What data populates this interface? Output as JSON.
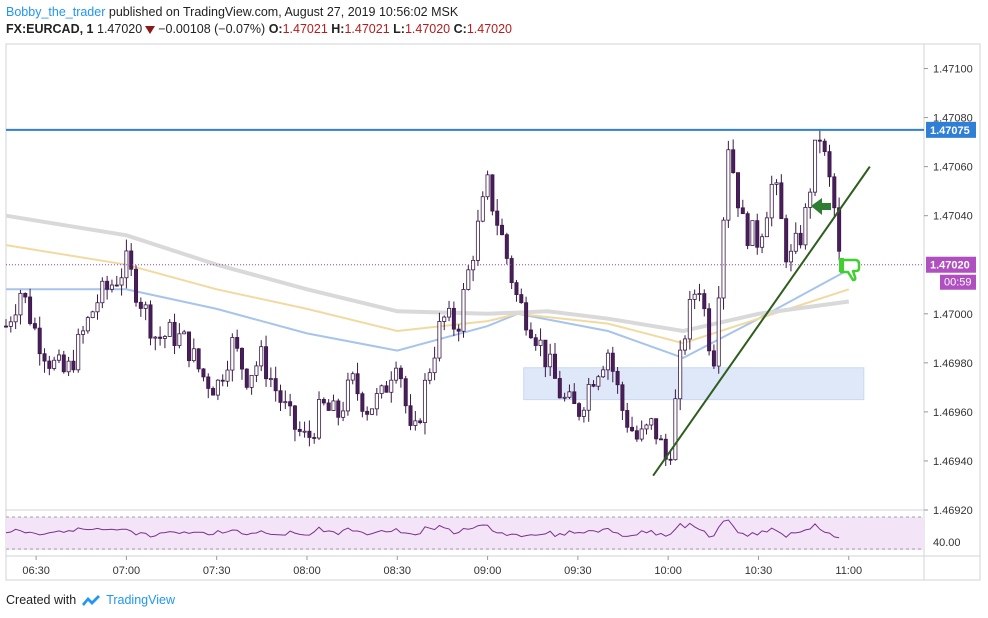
{
  "header": {
    "author": "Bobby_the_trader",
    "published": "published on TradingView.com, August 27, 2019 10:56:02 MSK",
    "symbol": "FX:EURCAD, 1",
    "last": "1.47020",
    "change": "−0.00108 (−0.07%)",
    "open_label": "O:",
    "open": "1.47021",
    "high_label": "H:",
    "high": "1.47021",
    "low_label": "L:",
    "low": "1.47020",
    "close_label": "C:",
    "close": "1.47020"
  },
  "price_axis": {
    "ticks": [
      "1.47100",
      "1.47080",
      "1.47060",
      "1.47040",
      "1.47000",
      "1.46980",
      "1.46960",
      "1.46940",
      "1.46920"
    ],
    "horizontal_line_label": "1.47075",
    "last_price_label": "1.47020",
    "countdown": "00:59"
  },
  "time_axis": {
    "ticks": [
      "06:30",
      "07:00",
      "07:30",
      "08:00",
      "08:30",
      "09:00",
      "09:30",
      "10:00",
      "10:30",
      "11:00"
    ]
  },
  "rsi": {
    "level_label": "40.00"
  },
  "footer": {
    "created_with": "Created with",
    "brand": "TradingView"
  },
  "colors": {
    "candle_up": "#ffffff",
    "candle_down": "#4a1d5c",
    "horizontal_line": "#2f7fd6",
    "trendline": "#2e5e1e",
    "ma_blue": "#a6c4ec",
    "ma_yellow": "#f2d9a0",
    "ma_grey": "#d9d9d9",
    "zone": "#dbe6f8",
    "rsi_line": "#7b2f8e",
    "rsi_band": "#f3e5f7",
    "thumb": "#3fcf2f",
    "arrow": "#2e7d32"
  },
  "chart_data": {
    "type": "candlestick",
    "timeframe": "1 minute",
    "x_range": [
      "06:20",
      "11:25"
    ],
    "ylim": [
      1.4692,
      1.4711
    ],
    "price_ticks": [
      1.471,
      1.4708,
      1.4706,
      1.4704,
      1.47,
      1.4698,
      1.4696,
      1.4694,
      1.4692
    ],
    "horizontal_level": 1.47075,
    "last_price": 1.4702,
    "support_zone": {
      "from": "09:12",
      "to": "11:05",
      "low": 1.46965,
      "high": 1.46978
    },
    "trendline": {
      "start": {
        "t": "09:55",
        "p": 1.46934
      },
      "end": {
        "t": "11:07",
        "p": 1.4706
      }
    },
    "price_path": [
      {
        "t": "06:20",
        "p": 1.46995
      },
      {
        "t": "06:25",
        "p": 1.4701
      },
      {
        "t": "06:30",
        "p": 1.46992
      },
      {
        "t": "06:35",
        "p": 1.4698
      },
      {
        "t": "06:40",
        "p": 1.46975
      },
      {
        "t": "06:45",
        "p": 1.4699
      },
      {
        "t": "06:50",
        "p": 1.47005
      },
      {
        "t": "06:55",
        "p": 1.47012
      },
      {
        "t": "07:00",
        "p": 1.4702
      },
      {
        "t": "07:05",
        "p": 1.47005
      },
      {
        "t": "07:10",
        "p": 1.4699
      },
      {
        "t": "07:15",
        "p": 1.46992
      },
      {
        "t": "07:20",
        "p": 1.46988
      },
      {
        "t": "07:25",
        "p": 1.46975
      },
      {
        "t": "07:30",
        "p": 1.4697
      },
      {
        "t": "07:35",
        "p": 1.46988
      },
      {
        "t": "07:40",
        "p": 1.46975
      },
      {
        "t": "07:45",
        "p": 1.46982
      },
      {
        "t": "07:50",
        "p": 1.46968
      },
      {
        "t": "07:55",
        "p": 1.46955
      },
      {
        "t": "08:00",
        "p": 1.46948
      },
      {
        "t": "08:05",
        "p": 1.46962
      },
      {
        "t": "08:10",
        "p": 1.46958
      },
      {
        "t": "08:15",
        "p": 1.46972
      },
      {
        "t": "08:20",
        "p": 1.46962
      },
      {
        "t": "08:25",
        "p": 1.46966
      },
      {
        "t": "08:30",
        "p": 1.46985
      },
      {
        "t": "08:35",
        "p": 1.46945
      },
      {
        "t": "08:40",
        "p": 1.46975
      },
      {
        "t": "08:45",
        "p": 1.46998
      },
      {
        "t": "08:50",
        "p": 1.46995
      },
      {
        "t": "08:55",
        "p": 1.47025
      },
      {
        "t": "09:00",
        "p": 1.47052
      },
      {
        "t": "09:05",
        "p": 1.4703
      },
      {
        "t": "09:10",
        "p": 1.47005
      },
      {
        "t": "09:15",
        "p": 1.46995
      },
      {
        "t": "09:20",
        "p": 1.4698
      },
      {
        "t": "09:25",
        "p": 1.46965
      },
      {
        "t": "09:30",
        "p": 1.4696
      },
      {
        "t": "09:35",
        "p": 1.46975
      },
      {
        "t": "09:40",
        "p": 1.46985
      },
      {
        "t": "09:45",
        "p": 1.4696
      },
      {
        "t": "09:50",
        "p": 1.46948
      },
      {
        "t": "09:55",
        "p": 1.46955
      },
      {
        "t": "10:00",
        "p": 1.46938
      },
      {
        "t": "10:05",
        "p": 1.4699
      },
      {
        "t": "10:10",
        "p": 1.47015
      },
      {
        "t": "10:15",
        "p": 1.4698
      },
      {
        "t": "10:20",
        "p": 1.4707
      },
      {
        "t": "10:25",
        "p": 1.47035
      },
      {
        "t": "10:30",
        "p": 1.4703
      },
      {
        "t": "10:35",
        "p": 1.47055
      },
      {
        "t": "10:40",
        "p": 1.4702
      },
      {
        "t": "10:45",
        "p": 1.47035
      },
      {
        "t": "10:50",
        "p": 1.47075
      },
      {
        "t": "10:55",
        "p": 1.47045
      },
      {
        "t": "10:57",
        "p": 1.4702
      }
    ],
    "moving_averages": [
      {
        "color": "blue",
        "points": [
          {
            "t": "06:20",
            "p": 1.4701
          },
          {
            "t": "07:00",
            "p": 1.4701
          },
          {
            "t": "07:30",
            "p": 1.47002
          },
          {
            "t": "08:00",
            "p": 1.46992
          },
          {
            "t": "08:30",
            "p": 1.46985
          },
          {
            "t": "09:00",
            "p": 1.46995
          },
          {
            "t": "09:10",
            "p": 1.47
          },
          {
            "t": "09:40",
            "p": 1.46993
          },
          {
            "t": "10:05",
            "p": 1.46982
          },
          {
            "t": "10:30",
            "p": 1.46998
          },
          {
            "t": "11:00",
            "p": 1.47018
          }
        ]
      },
      {
        "color": "yellow",
        "points": [
          {
            "t": "06:20",
            "p": 1.47028
          },
          {
            "t": "07:00",
            "p": 1.4702
          },
          {
            "t": "07:30",
            "p": 1.4701
          },
          {
            "t": "08:00",
            "p": 1.47002
          },
          {
            "t": "08:30",
            "p": 1.46993
          },
          {
            "t": "09:00",
            "p": 1.46997
          },
          {
            "t": "09:10",
            "p": 1.47
          },
          {
            "t": "09:40",
            "p": 1.46996
          },
          {
            "t": "10:05",
            "p": 1.46988
          },
          {
            "t": "10:30",
            "p": 1.46998
          },
          {
            "t": "11:00",
            "p": 1.4701
          }
        ]
      },
      {
        "color": "grey",
        "points": [
          {
            "t": "06:20",
            "p": 1.4704
          },
          {
            "t": "07:00",
            "p": 1.47032
          },
          {
            "t": "07:30",
            "p": 1.4702
          },
          {
            "t": "08:00",
            "p": 1.4701
          },
          {
            "t": "08:30",
            "p": 1.47001
          },
          {
            "t": "09:00",
            "p": 1.47
          },
          {
            "t": "09:20",
            "p": 1.47001
          },
          {
            "t": "09:40",
            "p": 1.46998
          },
          {
            "t": "10:05",
            "p": 1.46993
          },
          {
            "t": "10:30",
            "p": 1.47
          },
          {
            "t": "11:00",
            "p": 1.47005
          }
        ]
      }
    ],
    "rsi": {
      "level": 40,
      "band": [
        30,
        70
      ]
    }
  }
}
